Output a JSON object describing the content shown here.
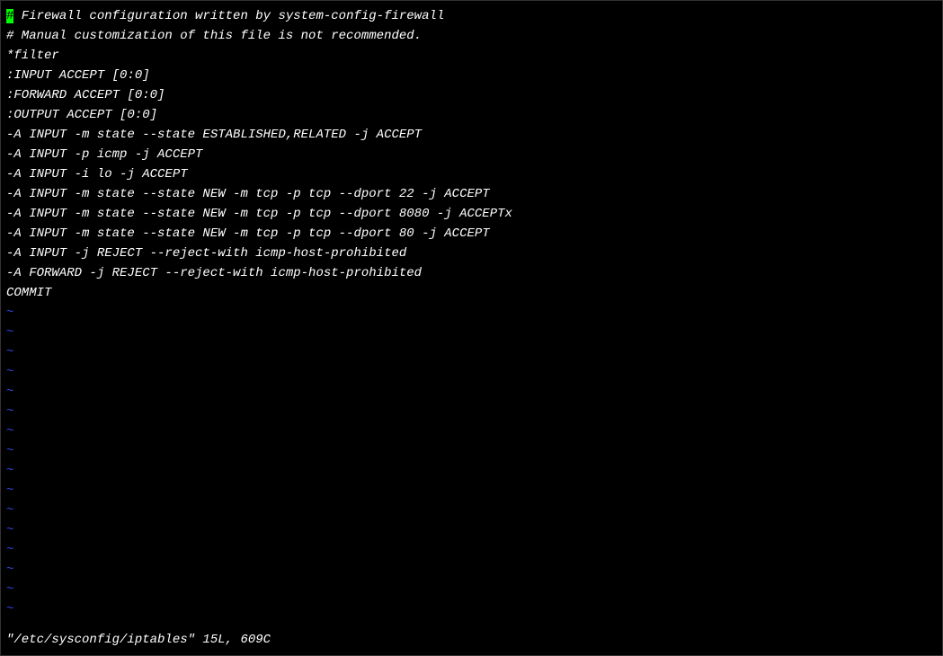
{
  "editor": {
    "cursor_char": "#",
    "first_line_remainder": " Firewall configuration written by system-config-firewall",
    "lines": [
      "# Manual customization of this file is not recommended.",
      "*filter",
      ":INPUT ACCEPT [0:0]",
      ":FORWARD ACCEPT [0:0]",
      ":OUTPUT ACCEPT [0:0]",
      "-A INPUT -m state --state ESTABLISHED,RELATED -j ACCEPT",
      "-A INPUT -p icmp -j ACCEPT",
      "-A INPUT -i lo -j ACCEPT",
      "-A INPUT -m state --state NEW -m tcp -p tcp --dport 22 -j ACCEPT",
      "-A INPUT -m state --state NEW -m tcp -p tcp --dport 8080 -j ACCEPTx",
      "-A INPUT -m state --state NEW -m tcp -p tcp --dport 80 -j ACCEPT",
      "-A INPUT -j REJECT --reject-with icmp-host-prohibited",
      "-A FORWARD -j REJECT --reject-with icmp-host-prohibited",
      "COMMIT"
    ],
    "empty_line_marker": "~",
    "empty_line_count": 16
  },
  "status": {
    "text": "\"/etc/sysconfig/iptables\" 15L, 609C"
  }
}
